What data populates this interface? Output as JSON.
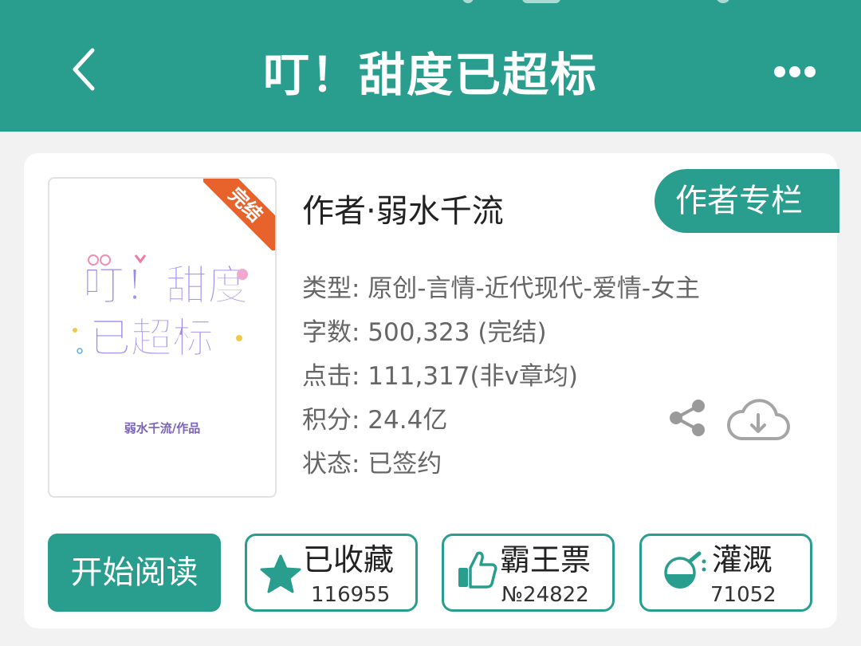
{
  "header": {
    "title": "叮！甜度已超标",
    "back_icon": "chevron-left-icon",
    "more_icon": "more-dots-icon",
    "color": "#2a9e8e"
  },
  "book": {
    "cover": {
      "badge": "完结",
      "art_text_line1": "叮！甜度",
      "art_text_line2": "已超标",
      "author_line": "弱水千流/作品"
    },
    "author": "作者·弱水千流",
    "author_column_label": "作者专栏",
    "meta": {
      "type": "类型: 原创-言情-近代现代-爱情-女主",
      "words": "字数: 500,323 (完结)",
      "clicks": "点击: 111,317(非v章均)",
      "score": "积分: 24.4亿",
      "status": "状态: 已签约"
    }
  },
  "actions": {
    "read_label": "开始阅读",
    "collect": {
      "label": "已收藏",
      "count": "116955",
      "icon": "star-icon"
    },
    "vote": {
      "label": "霸王票",
      "count": "№24822",
      "icon": "thumbs-up-icon"
    },
    "water": {
      "label": "灌溉",
      "count": "71052",
      "icon": "flask-icon"
    }
  }
}
